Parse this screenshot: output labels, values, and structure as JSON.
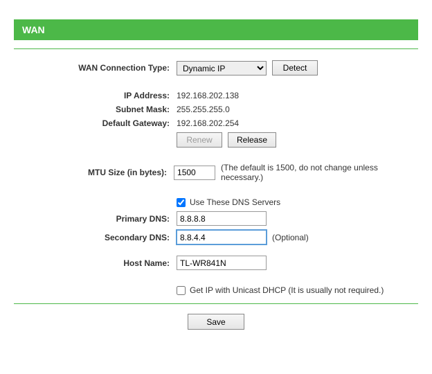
{
  "header": {
    "title": "WAN"
  },
  "labels": {
    "connection_type": "WAN Connection Type:",
    "ip_address": "IP Address:",
    "subnet_mask": "Subnet Mask:",
    "default_gateway": "Default Gateway:",
    "mtu_size": "MTU Size (in bytes):",
    "primary_dns": "Primary DNS:",
    "secondary_dns": "Secondary DNS:",
    "host_name": "Host Name:"
  },
  "values": {
    "connection_type": "Dynamic IP",
    "ip_address": "192.168.202.138",
    "subnet_mask": "255.255.255.0",
    "default_gateway": "192.168.202.254",
    "mtu_size": "1500",
    "primary_dns": "8.8.8.8",
    "secondary_dns": "8.8.4.4",
    "host_name": "TL-WR841N"
  },
  "checkboxes": {
    "use_dns_label": "Use These DNS Servers",
    "use_dns_checked": true,
    "unicast_label": "Get IP with Unicast DHCP (It is usually not required.)",
    "unicast_checked": false
  },
  "buttons": {
    "detect": "Detect",
    "renew": "Renew",
    "release": "Release",
    "save": "Save"
  },
  "hints": {
    "mtu": "(The default is 1500, do not change unless necessary.)",
    "secondary_dns": "(Optional)"
  }
}
